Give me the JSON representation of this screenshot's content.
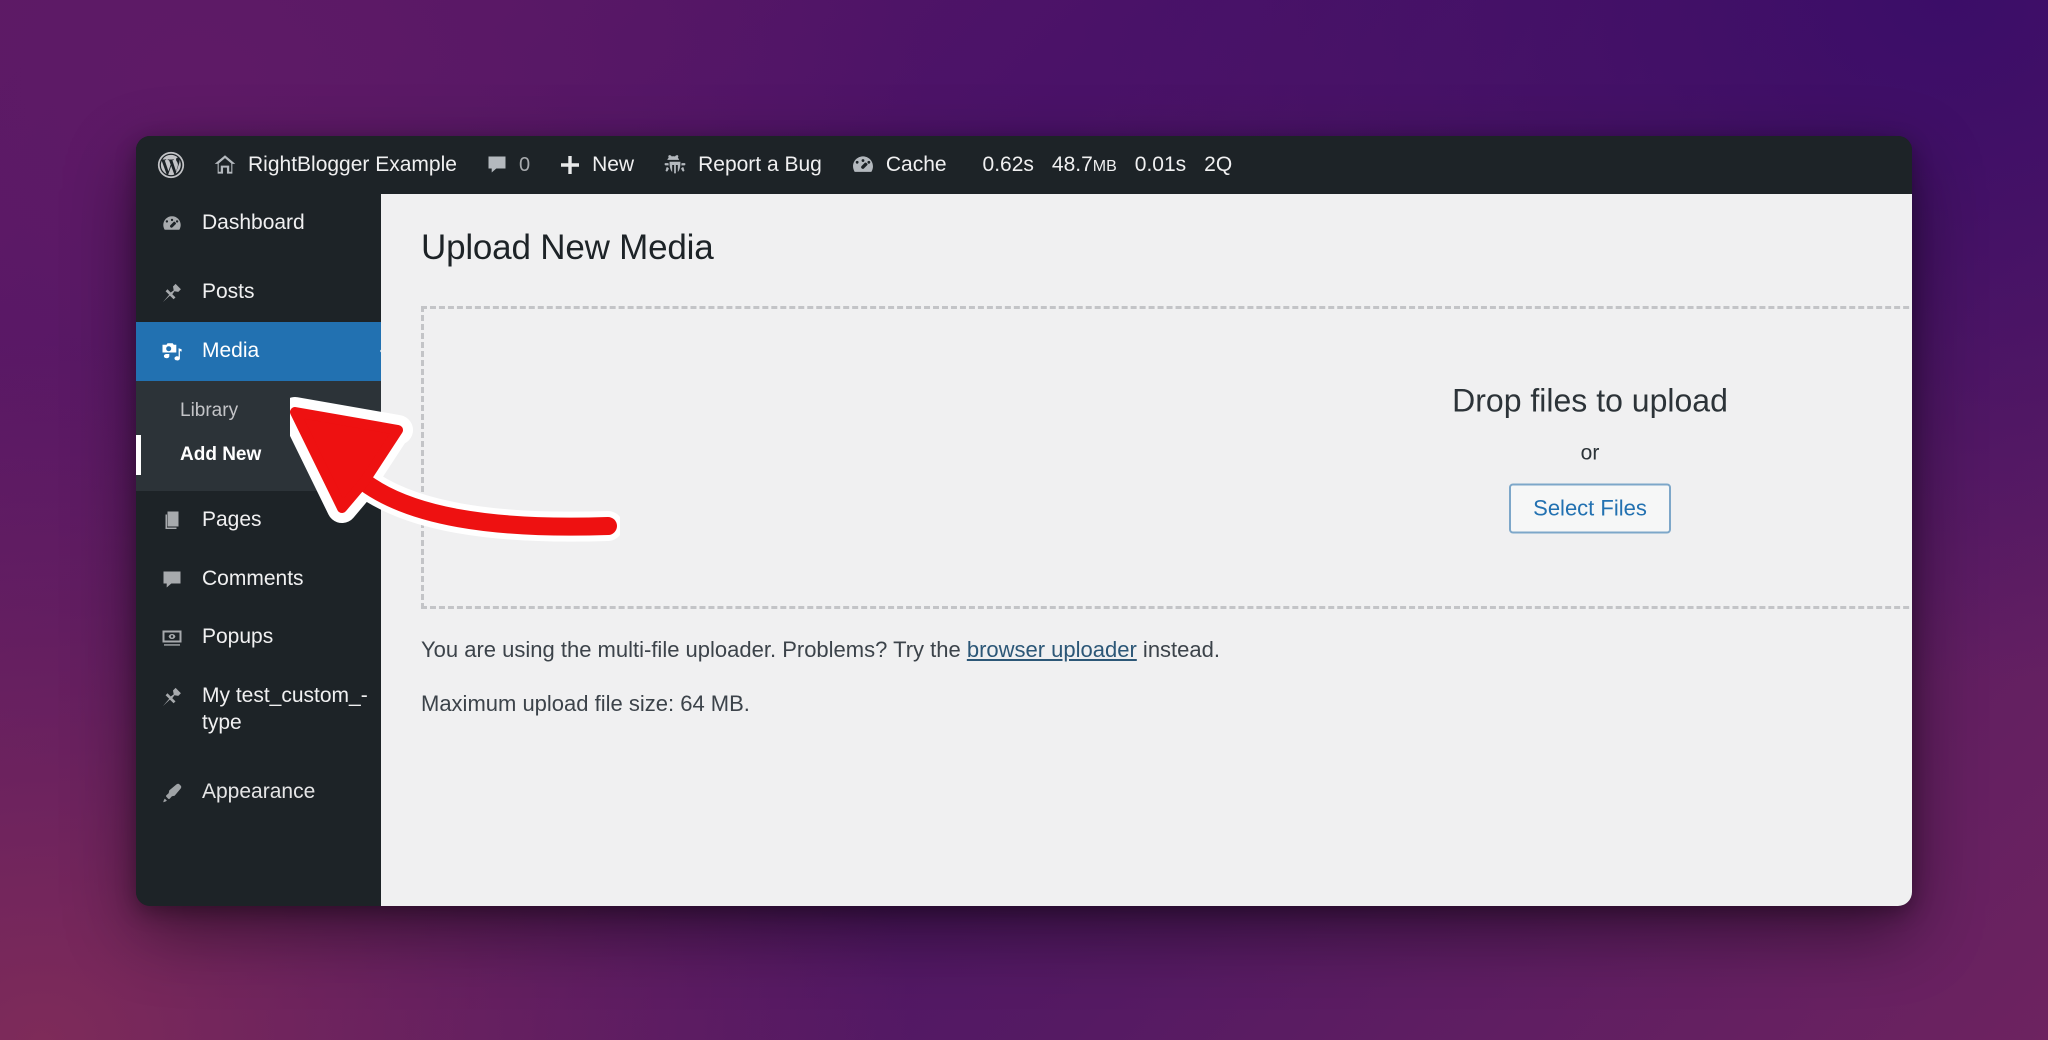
{
  "adminbar": {
    "logo_icon": "wordpress-logo-icon",
    "site_icon": "home-icon",
    "site_name": "RightBlogger Example",
    "comments_icon": "comment-bubble-icon",
    "comments_count": "0",
    "new_icon": "plus-icon",
    "new_label": "New",
    "bug_icon": "bug-icon",
    "bug_label": "Report a Bug",
    "cache_icon": "gauge-icon",
    "cache_label": "Cache",
    "stats": {
      "time": "0.62s",
      "memory_value": "48.7",
      "memory_unit": "MB",
      "db_time": "0.01s",
      "queries": "2Q"
    }
  },
  "sidebar": {
    "items": [
      {
        "label": "Dashboard",
        "icon": "dashboard-gauge-icon"
      },
      {
        "label": "Posts",
        "icon": "pin-icon"
      },
      {
        "label": "Media",
        "icon": "media-camera-icon",
        "current": true
      },
      {
        "label": "Pages",
        "icon": "pages-icon"
      },
      {
        "label": "Comments",
        "icon": "comment-bubble-icon"
      },
      {
        "label": "Popups",
        "icon": "popups-eye-icon"
      },
      {
        "label": "My test_custom_-type",
        "icon": "pin-icon"
      },
      {
        "label": "Appearance",
        "icon": "appearance-brush-icon"
      }
    ],
    "submenu": [
      {
        "label": "Library",
        "current": false
      },
      {
        "label": "Add New",
        "current": true
      }
    ]
  },
  "main": {
    "page_title": "Upload New Media",
    "dropzone": {
      "headline": "Drop files to upload",
      "or_label": "or",
      "select_button": "Select Files"
    },
    "notes": {
      "uploader_prefix": "You are using the multi-file uploader. Problems? Try the ",
      "uploader_link": "browser uploader",
      "uploader_suffix": " instead.",
      "max_size": "Maximum upload file size: 64 MB."
    }
  },
  "annotation": {
    "type": "curved-arrow",
    "color": "#ee1111",
    "outline_color": "#ffffff",
    "points_to": "Add New"
  },
  "colors": {
    "accent_blue": "#2271b1",
    "admin_dark": "#1d2327",
    "submenu_dark": "#2c3338",
    "content_bg": "#f0f0f1",
    "link": "#2c5777",
    "annotation_red": "#ee1111"
  }
}
